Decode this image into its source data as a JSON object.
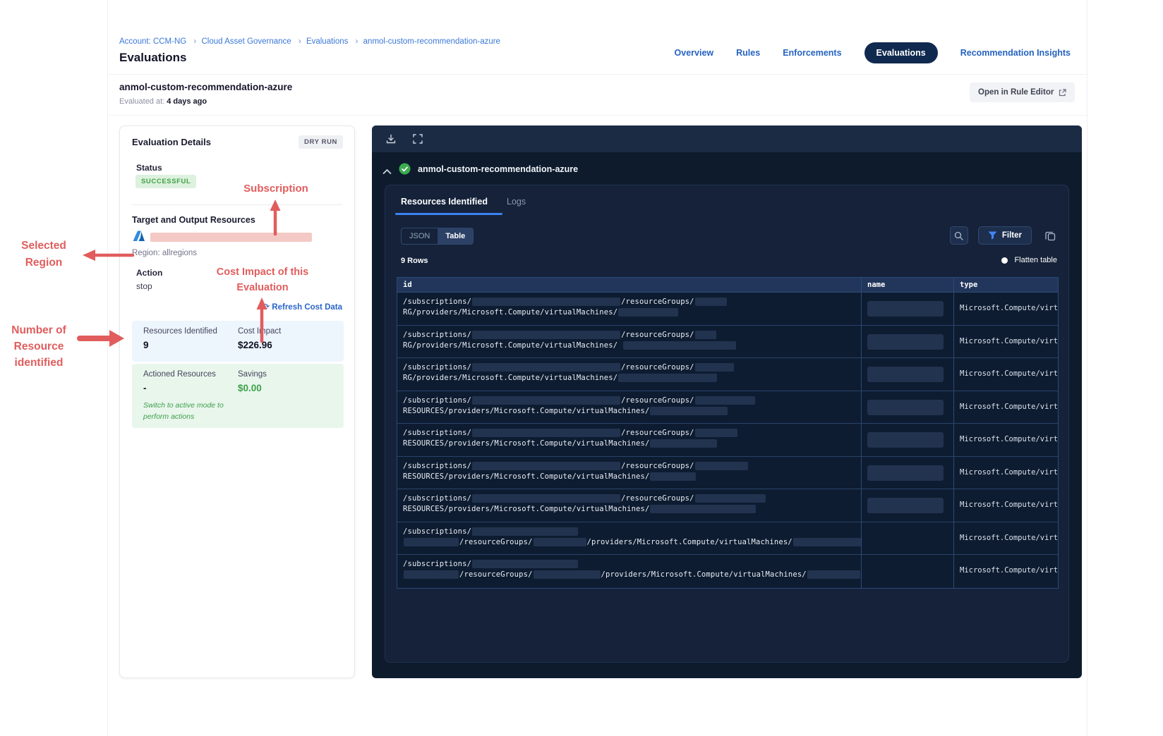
{
  "colors": {
    "accent_blue": "#2563c0",
    "breadcrumb_blue": "#3b78d8",
    "active_pill_navy": "#10294f",
    "panel_dark_navy": "#0d1b2d",
    "panel_inner_navy": "#15223a",
    "table_border_blue": "#2b4a77",
    "annotation_red": "#e15d5d",
    "success_green": "#43a047",
    "redaction_pink": "#f4c9c5",
    "tab_underline_blue": "#3c82f2"
  },
  "breadcrumb": {
    "items": [
      "Account: CCM-NG",
      "Cloud Asset Governance",
      "Evaluations",
      "anmol-custom-recommendation-azure"
    ],
    "separator": "›"
  },
  "page_title": "Evaluations",
  "nav": {
    "items": [
      {
        "label": "Overview",
        "active": false
      },
      {
        "label": "Rules",
        "active": false
      },
      {
        "label": "Enforcements",
        "active": false
      },
      {
        "label": "Evaluations",
        "active": true
      },
      {
        "label": "Recommendation Insights",
        "active": false
      }
    ]
  },
  "subheader": {
    "title": "anmol-custom-recommendation-azure",
    "evaluated_label": "Evaluated at:",
    "evaluated_value": "4 days ago",
    "open_rule_editor_label": "Open in Rule Editor"
  },
  "details_card": {
    "title": "Evaluation Details",
    "mode_badge": "DRY RUN",
    "status_label": "Status",
    "status_value": "SUCCESSFUL",
    "target_section_title": "Target and Output Resources",
    "region_text": "Region: allregions",
    "action_label": "Action",
    "action_value": "stop",
    "refresh_glyph": "⟳",
    "refresh_link": "Refresh Cost Data",
    "resources_identified_label": "Resources Identified",
    "resources_identified_value": "9",
    "cost_impact_label": "Cost Impact",
    "cost_impact_value": "$226.96",
    "actioned_resources_label": "Actioned Resources",
    "actioned_resources_value": "-",
    "savings_label": "Savings",
    "savings_value": "$0.00",
    "active_mode_note_line1": "Switch to active mode to",
    "active_mode_note_line2": "perform actions"
  },
  "annotations": {
    "subscription": "Subscription",
    "selected_region_line1": "Selected",
    "selected_region_line2": "Region",
    "cost_impact_line1": "Cost Impact of this",
    "cost_impact_line2": "Evaluation",
    "resource_count_line1": "Number of",
    "resource_count_line2": "Resource",
    "resource_count_line3": "identified"
  },
  "results_panel": {
    "result_title": "anmol-custom-recommendation-azure",
    "tabs": [
      {
        "label": "Resources Identified",
        "active": true
      },
      {
        "label": "Logs",
        "active": false
      }
    ],
    "view_toggle": [
      {
        "label": "JSON",
        "active": false
      },
      {
        "label": "Table",
        "active": true
      }
    ],
    "filter_button_label": "Filter",
    "rows_count": "9 Rows",
    "flatten_label": "Flatten table",
    "table": {
      "columns": [
        "id",
        "name",
        "type"
      ],
      "rows": [
        {
          "id_line1": [
            {
              "text": "/subscriptions/"
            },
            {
              "redact": 210
            },
            {
              "text": "/resourceGroups/"
            },
            {
              "redact": 45
            }
          ],
          "id_line2": [
            {
              "text": "RG/providers/Microsoft.Compute/virtualMachines/"
            },
            {
              "redact": 85
            }
          ],
          "name_redacted": true,
          "type": "Microsoft.Compute/virtu"
        },
        {
          "id_line1": [
            {
              "text": "/subscriptions/"
            },
            {
              "redact": 210
            },
            {
              "text": "/resourceGroups/"
            },
            {
              "redact": 30
            }
          ],
          "id_line2": [
            {
              "text": "RG/providers/Microsoft.Compute/virtualMachines/ "
            },
            {
              "redact": 160
            }
          ],
          "name_redacted": true,
          "type": "Microsoft.Compute/virtu"
        },
        {
          "id_line1": [
            {
              "text": "/subscriptions/"
            },
            {
              "redact": 210
            },
            {
              "text": "/resourceGroups/"
            },
            {
              "redact": 55
            }
          ],
          "id_line2": [
            {
              "text": "RG/providers/Microsoft.Compute/virtualMachines/"
            },
            {
              "redact": 140
            }
          ],
          "name_redacted": true,
          "type": "Microsoft.Compute/virtu"
        },
        {
          "id_line1": [
            {
              "text": "/subscriptions/"
            },
            {
              "redact": 210
            },
            {
              "text": "/resourceGroups/"
            },
            {
              "redact": 85
            }
          ],
          "id_line2": [
            {
              "text": "RESOURCES/providers/Microsoft.Compute/virtualMachines/"
            },
            {
              "redact": 110
            }
          ],
          "name_redacted": true,
          "type": "Microsoft.Compute/virtu"
        },
        {
          "id_line1": [
            {
              "text": "/subscriptions/"
            },
            {
              "redact": 210
            },
            {
              "text": "/resourceGroups/"
            },
            {
              "redact": 60
            }
          ],
          "id_line2": [
            {
              "text": "RESOURCES/providers/Microsoft.Compute/virtualMachines/"
            },
            {
              "redact": 95
            }
          ],
          "name_redacted": true,
          "type": "Microsoft.Compute/virtu"
        },
        {
          "id_line1": [
            {
              "text": "/subscriptions/"
            },
            {
              "redact": 210
            },
            {
              "text": "/resourceGroups/"
            },
            {
              "redact": 75
            }
          ],
          "id_line2": [
            {
              "text": "RESOURCES/providers/Microsoft.Compute/virtualMachines/"
            },
            {
              "redact": 65
            }
          ],
          "name_redacted": true,
          "type": "Microsoft.Compute/virtu"
        },
        {
          "id_line1": [
            {
              "text": "/subscriptions/"
            },
            {
              "redact": 210
            },
            {
              "text": "/resourceGroups/"
            },
            {
              "redact": 100
            }
          ],
          "id_line2": [
            {
              "text": "RESOURCES/providers/Microsoft.Compute/virtualMachines/"
            },
            {
              "redact": 150
            }
          ],
          "name_redacted": true,
          "type": "Microsoft.Compute/virtu"
        },
        {
          "id_line1": [
            {
              "text": "/subscriptions/"
            },
            {
              "redact": 150
            }
          ],
          "id_line2": [
            {
              "redact": 78
            },
            {
              "text": "/resourceGroups/"
            },
            {
              "redact": 75
            },
            {
              "text": "/providers/Microsoft.Compute/virtualMachines/"
            },
            {
              "redact": 110
            }
          ],
          "name_redacted": false,
          "type": "Microsoft.Compute/virtu"
        },
        {
          "id_line1": [
            {
              "text": "/subscriptions/"
            },
            {
              "redact": 150
            }
          ],
          "id_line2": [
            {
              "redact": 78
            },
            {
              "text": "/resourceGroups/"
            },
            {
              "redact": 95
            },
            {
              "text": "/providers/Microsoft.Compute/virtualMachines/"
            },
            {
              "redact": 75
            }
          ],
          "name_redacted": false,
          "type": "Microsoft.Compute/virtu"
        }
      ]
    }
  },
  "icons": [
    "download-icon",
    "fullscreen-icon",
    "chevron-up-icon",
    "check-circle-icon",
    "search-icon",
    "filter-icon",
    "copy-icon",
    "refresh-icon",
    "external-link-icon",
    "azure-icon",
    "flatten-toggle-dot",
    "arrow-annotations"
  ]
}
